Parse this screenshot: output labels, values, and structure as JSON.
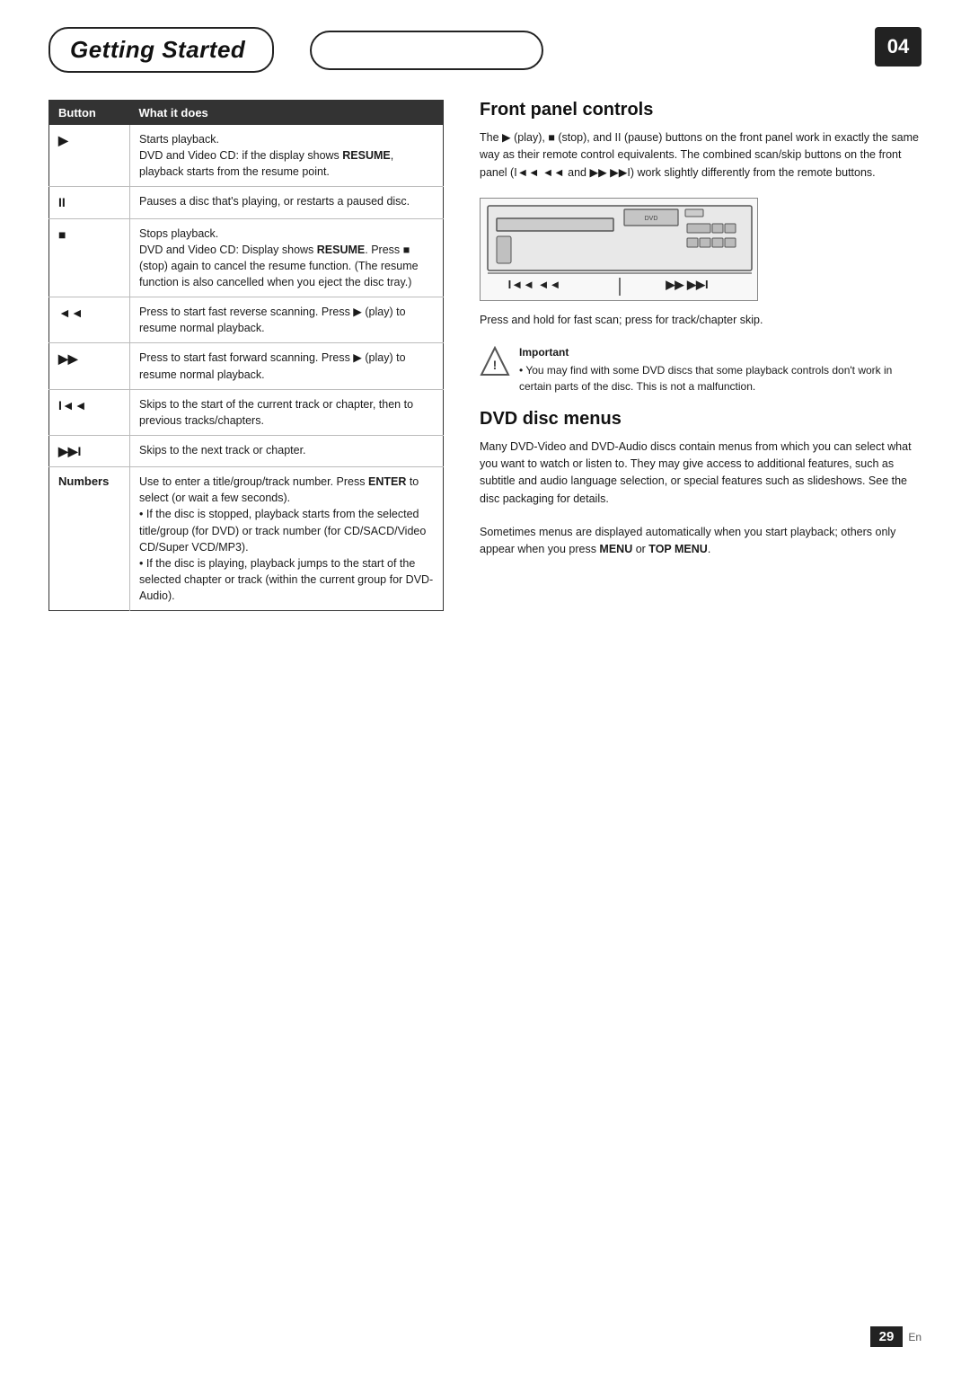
{
  "header": {
    "title": "Getting Started",
    "page_number": "04",
    "center_box_label": ""
  },
  "table": {
    "col1_header": "Button",
    "col2_header": "What it does",
    "rows": [
      {
        "button": "▶",
        "description": "Starts playback.\nDVD and Video CD: if the display shows RESUME, playback starts from the resume point.",
        "resume_bold": true
      },
      {
        "button": "II",
        "description": "Pauses a disc that's playing, or restarts a paused disc."
      },
      {
        "button": "■",
        "description": "Stops playback.\nDVD and Video CD: Display shows RESUME. Press ■ (stop) again to cancel the resume function. (The resume function is also cancelled when you eject the disc tray.)"
      },
      {
        "button": "◄◄",
        "description": "Press to start fast reverse scanning. Press ▶ (play) to resume normal playback."
      },
      {
        "button": "▶▶",
        "description": "Press to start fast forward scanning. Press ▶ (play) to resume normal playback."
      },
      {
        "button": "I◄◄",
        "description": "Skips to the start of the current track or chapter, then to previous tracks/chapters."
      },
      {
        "button": "▶▶I",
        "description": "Skips to the next track or chapter."
      },
      {
        "button": "Numbers",
        "description": "Use to enter a title/group/track number. Press ENTER to select (or wait a few seconds).\n• If the disc is stopped, playback starts from the selected title/group (for DVD) or track number (for CD/SACD/Video CD/Super VCD/MP3).\n• If the disc is playing, playback jumps to the start of the selected chapter or track (within the current group for DVD-Audio).",
        "is_numbers": true
      }
    ]
  },
  "front_panel": {
    "title": "Front panel controls",
    "body": "The ▶ (play), ■ (stop), and II (pause) buttons on the front panel work in exactly the same way as their remote control equivalents. The combined scan/skip buttons on the front panel (I◄◄ ◄◄ and ▶▶ ▶▶I) work slightly differently from the remote buttons.",
    "diagram_label": "I◄◄  ◄◄         ▶▶  ▶▶I",
    "caption": "Press and hold for fast scan; press for track/chapter skip.",
    "important_title": "Important",
    "important_text": "• You may find with some DVD discs that some playback controls don't work in certain parts of the disc. This is not a malfunction."
  },
  "dvd_disc_menus": {
    "title": "DVD disc menus",
    "body1": "Many DVD-Video and DVD-Audio discs contain menus from which you can select what you want to watch or listen to. They may give access to additional features, such as subtitle and audio language selection, or special features such as slideshows. See the disc packaging for details.",
    "body2": "Sometimes menus are displayed automatically when you start playback; others only appear when you press MENU or TOP MENU."
  },
  "footer": {
    "page_number": "29",
    "language": "En"
  }
}
